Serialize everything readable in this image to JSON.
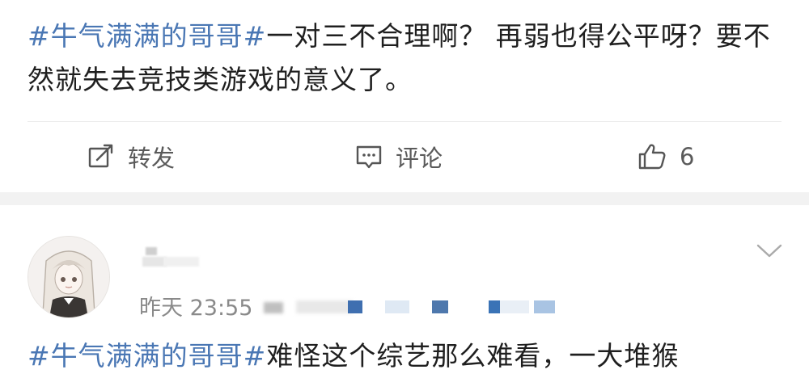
{
  "post1": {
    "hashtag": "#牛气满满的哥哥#",
    "text": "一对三不合理啊？ 再弱也得公平呀？要不然就失去竞技类游戏的意义了。"
  },
  "actions": {
    "repost_label": "转发",
    "comment_label": "评论",
    "like_count": "6"
  },
  "comment": {
    "timestamp": "昨天 23:55",
    "hashtag": "#牛气满满的哥哥#",
    "text": "难怪这个综艺那么难看，一大堆猴"
  },
  "colors": {
    "hashtag": "#4a77b4",
    "secondary_text": "#8a8a8a",
    "separator": "#f2f2f2"
  },
  "icons": [
    "repost-icon",
    "comment-icon",
    "like-icon",
    "chevron-down-icon"
  ]
}
